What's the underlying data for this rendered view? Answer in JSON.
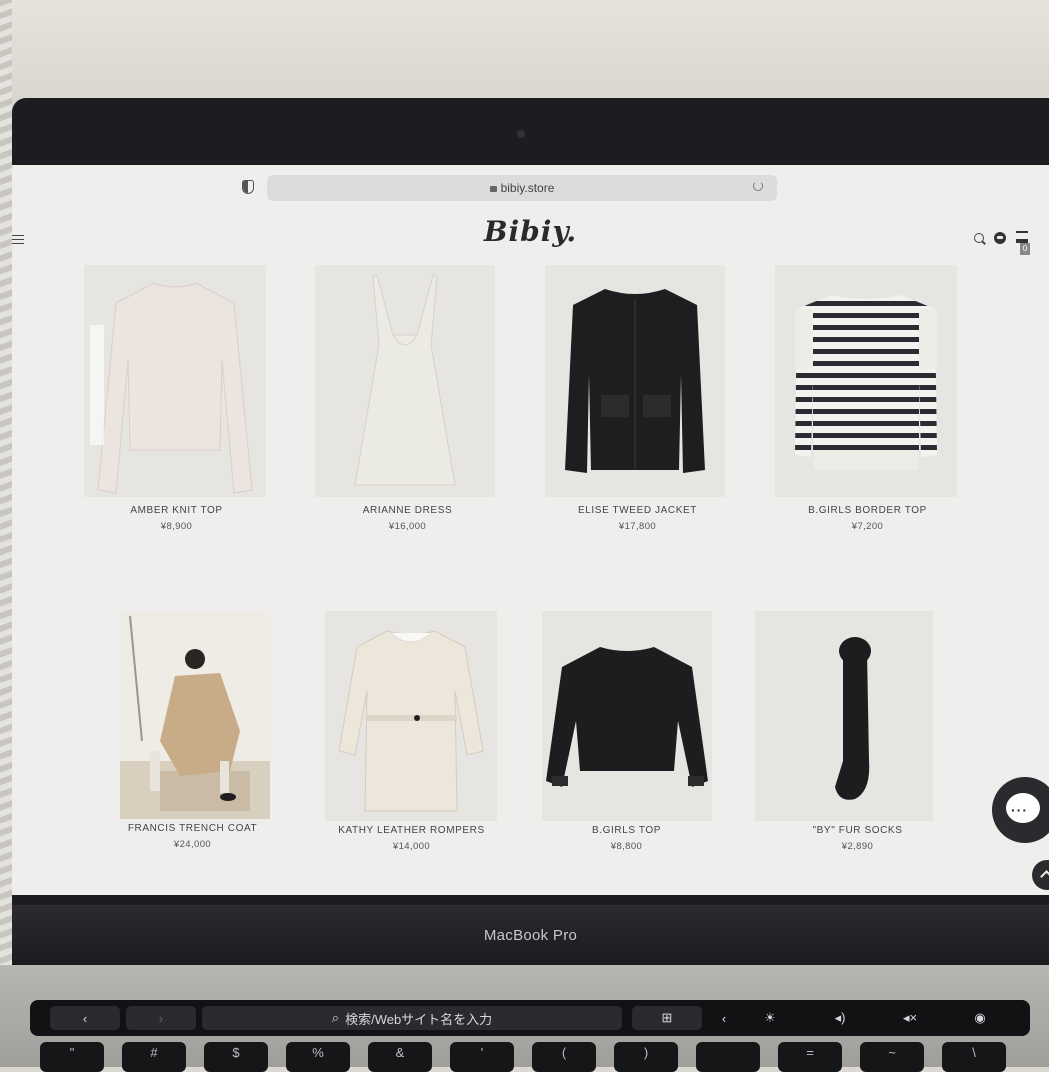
{
  "browser": {
    "url": "bibiy.store"
  },
  "site": {
    "logo": "Bibiy.",
    "cart_count": "0"
  },
  "products": [
    {
      "name": "AMBER KNIT TOP",
      "price": "¥8,900"
    },
    {
      "name": "ARIANNE DRESS",
      "price": "¥16,000"
    },
    {
      "name": "ELISE TWEED JACKET",
      "price": "¥17,800"
    },
    {
      "name": "B.GIRLS BORDER TOP",
      "price": "¥7,200"
    },
    {
      "name": "FRANCIS TRENCH COAT",
      "price": "¥24,000"
    },
    {
      "name": "KATHY LEATHER ROMPERS",
      "price": "¥14,000"
    },
    {
      "name": "B.GIRLS TOP",
      "price": "¥8,800"
    },
    {
      "name": "\"BY\" FUR SOCKS",
      "price": "¥2,890"
    }
  ],
  "device": {
    "model_label": "MacBook Pro",
    "touchbar_search": "検索/Webサイト名を入力"
  },
  "keyboard": {
    "keys": [
      "\"",
      "#",
      "$",
      "%",
      "&",
      "'",
      "(",
      ")",
      "",
      "=",
      "~",
      "\\"
    ]
  }
}
